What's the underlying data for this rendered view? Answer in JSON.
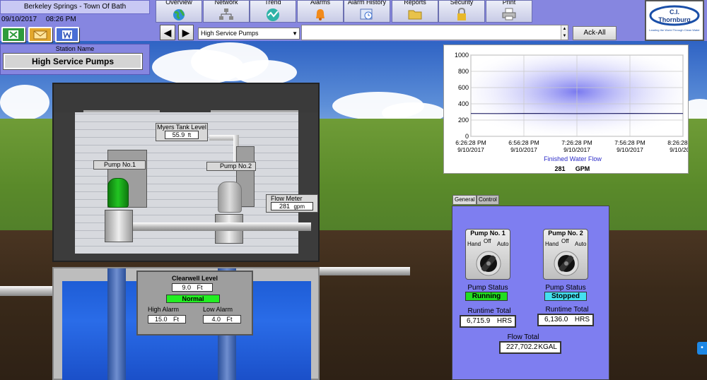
{
  "header": {
    "location": "Berkeley Springs - Town Of Bath",
    "date": "09/10/2017",
    "time": "08:26 PM",
    "nav": [
      {
        "label": "Overview",
        "icon": "globe-icon"
      },
      {
        "label": "Network",
        "icon": "network-icon"
      },
      {
        "label": "Trend",
        "icon": "trend-icon"
      },
      {
        "label": "Alarms",
        "icon": "bell-icon"
      },
      {
        "label": "Alarm History",
        "icon": "alarm-history-icon"
      },
      {
        "label": "Reports",
        "icon": "folder-icon"
      },
      {
        "label": "Security",
        "icon": "lock-icon"
      },
      {
        "label": "Print",
        "icon": "printer-icon"
      }
    ],
    "station_select": "High Service Pumps",
    "ack_label": "Ack-All",
    "logo": {
      "line1": "C.I.",
      "line2": "Thornburg",
      "tagline": "Leading the World Through Clean Water"
    }
  },
  "station": {
    "header": "Station Name",
    "button": "High Service Pumps"
  },
  "pump_house": {
    "tank_label": "Myers Tank Level",
    "tank_value": "55.9",
    "tank_unit": "ft",
    "pump1_label": "Pump No.1",
    "pump2_label": "Pump No.2",
    "flow_label": "Flow Meter",
    "flow_value": "281",
    "flow_unit": "gpm",
    "pump1_color": "#22c422",
    "pump2_color": "#dcdcdc"
  },
  "clearwell": {
    "title": "Clearwell Level",
    "value": "9.0",
    "unit": "Ft",
    "status": "Normal",
    "high_label": "High Alarm",
    "high_value": "15.0",
    "high_unit": "Ft",
    "low_label": "Low Alarm",
    "low_value": "4.0",
    "low_unit": "Ft"
  },
  "chart_data": {
    "type": "line",
    "title": "",
    "yticks": [
      "0",
      "200",
      "400",
      "600",
      "800",
      "1000"
    ],
    "ylim": [
      0,
      1000
    ],
    "xticks": [
      {
        "time": "6:26:28 PM",
        "date": "9/10/2017"
      },
      {
        "time": "6:56:28 PM",
        "date": "9/10/2017"
      },
      {
        "time": "7:26:28 PM",
        "date": "9/10/2017"
      },
      {
        "time": "7:56:28 PM",
        "date": "9/10/2017"
      },
      {
        "time": "8:26:28 PM",
        "date": "9/10/2017"
      }
    ],
    "series": [
      {
        "name": "Finished Water Flow",
        "values": [
          281,
          280,
          282,
          281,
          280,
          281,
          282,
          281,
          281
        ]
      }
    ],
    "current_value": "281",
    "unit": "GPM",
    "grid": true
  },
  "tabs": [
    "General",
    "Control"
  ],
  "pumps": [
    {
      "title": "Pump No. 1",
      "hand": "Hand",
      "off": "Off",
      "auto": "Auto",
      "status_label": "Pump Status",
      "status": "Running",
      "status_color": "#22dd22",
      "runtime_label": "Runtime Total",
      "runtime": "6,715.9",
      "runtime_unit": "HRS"
    },
    {
      "title": "Pump No. 2",
      "hand": "Hand",
      "off": "Off",
      "auto": "Auto",
      "status_label": "Pump Status",
      "status": "Stopped",
      "status_color": "#44e0f0",
      "runtime_label": "Runtime Total",
      "runtime": "6,136.0",
      "runtime_unit": "HRS"
    }
  ],
  "flow_total": {
    "label": "Flow Total",
    "value": "227,702.2",
    "unit": "KGAL"
  }
}
